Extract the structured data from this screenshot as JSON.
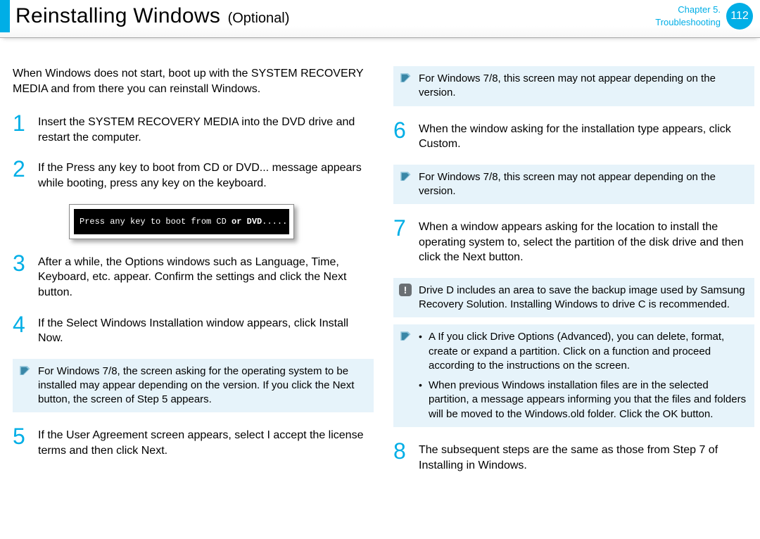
{
  "header": {
    "title": "Reinstalling Windows",
    "subtitle": "(Optional)",
    "chapter_line1": "Chapter 5.",
    "chapter_line2": "Troubleshooting",
    "page_number": "112"
  },
  "left": {
    "intro": "When Windows does not start, boot up with the SYSTEM RECOVERY MEDIA and from there you can reinstall Windows.",
    "step1_num": "1",
    "step1a": "Insert the ",
    "step1b": "SYSTEM RECOVERY MEDIA",
    "step1c": " into the DVD drive and restart the computer.",
    "step2_num": "2",
    "step2a": "If the ",
    "step2b": "Press any key to boot from CD or DVD...",
    "step2c": " message appears while booting, press any key on the keyboard.",
    "console_pre": "Press any key to boot from CD ",
    "console_mid": "or DVD",
    "console_post": ".....",
    "step3_num": "3",
    "step3": "After a while, the Options windows such as Language, Time, Keyboard, etc. appear. Conﬁrm the settings and click the Next button.",
    "step4_num": "4",
    "step4a": "If the ",
    "step4b": "Select Windows Installation",
    "step4c": " window appears, click ",
    "step4d": "Install Now",
    "step4e": ".",
    "note4a": "For Windows 7/8, the screen asking for the operating system to be installed may appear depending on the version. If you click the ",
    "note4b": "Next",
    "note4c": " button, the screen of Step 5 appears.",
    "step5_num": "5",
    "step5a": "If the User Agreement screen appears, select ",
    "step5b": "I accept the license terms",
    "step5c": " and then click ",
    "step5d": "Next",
    "step5e": "."
  },
  "right": {
    "note_top": "For Windows 7/8, this screen may not appear depending on the version.",
    "step6_num": "6",
    "step6a": "When the window asking for the installation type appears, click ",
    "step6b": "Custom",
    "step6c": ".",
    "note6": "For Windows 7/8, this screen may not appear depending on the version.",
    "step7_num": "7",
    "step7": "When a window appears asking for the location to install the operating system to, select the partition of the disk drive and then click the Next button.",
    "alert7": "Drive D includes an area to save the backup image used by Samsung Recovery Solution. Installing Windows to drive C is recommended.",
    "note7_li1a": "A If you click ",
    "note7_li1b": "Drive Options (Advanced)",
    "note7_li1c": ", you can delete, format, create or expand a partition. Click on a function and proceed according to the instructions on the screen.",
    "note7_li2a": "When previous Windows installation ﬁles are in the selected partition, a message appears informing you that the ﬁles and folders will be moved to the Windows.old folder. Click the ",
    "note7_li2b": "OK",
    "note7_li2c": " button.",
    "step8_num": "8",
    "step8": "The subsequent steps are the same as those from Step 7 of Installing in Windows."
  }
}
